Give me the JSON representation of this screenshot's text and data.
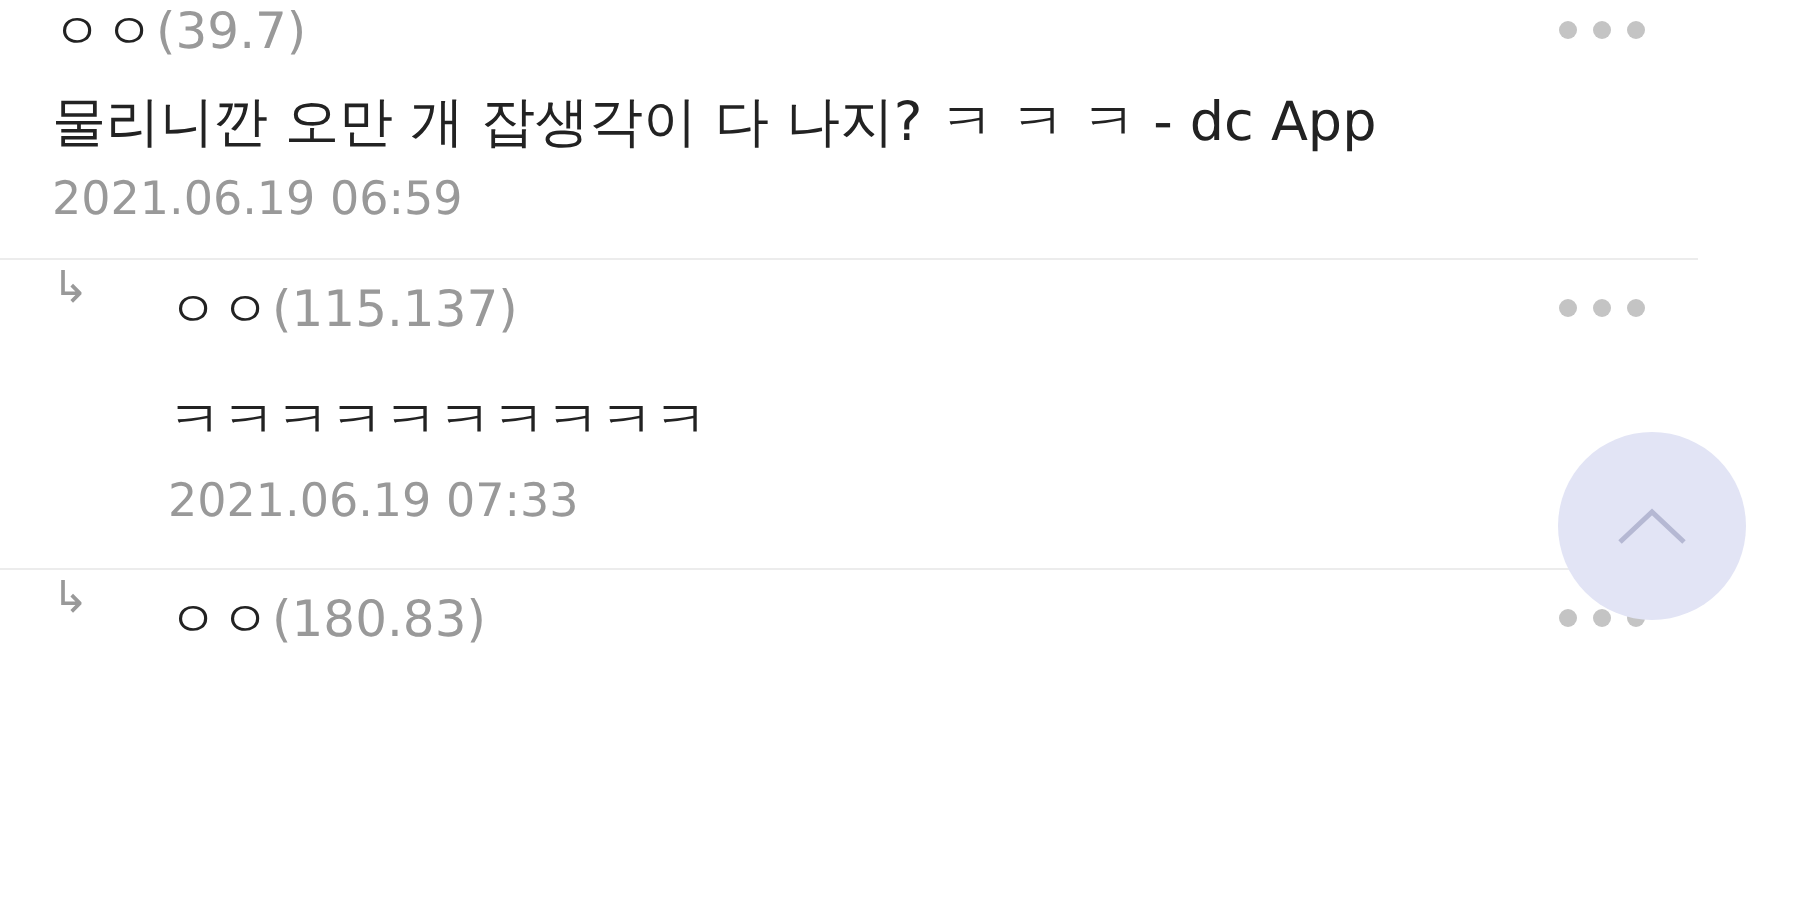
{
  "comments": [
    {
      "kind": "comment",
      "author": "ㅇㅇ",
      "ip": "(39.7)",
      "text": "물리니깐 오만 개 잡생각이 다 나지? ㅋ ㅋ ㅋ - dc App",
      "date": "2021.06.19 06:59"
    },
    {
      "kind": "reply",
      "reply_mark": "↳",
      "author": "ㅇㅇ",
      "ip": "(115.137)",
      "text": "ㅋㅋㅋㅋㅋㅋㅋㅋㅋㅋ",
      "date": "2021.06.19 07:33"
    },
    {
      "kind": "reply",
      "reply_mark": "↳",
      "author": "ㅇㅇ",
      "ip": "(180.83)"
    }
  ]
}
